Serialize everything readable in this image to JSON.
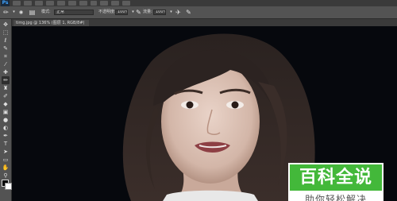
{
  "app": {
    "logo": "Ps"
  },
  "options_bar": {
    "mode_label": "模式:",
    "mode_value": "正常",
    "opacity_label": "不透明度:",
    "opacity_value": "100%",
    "flow_label": "流量:",
    "flow_value": "100%"
  },
  "document": {
    "tab_label": "timg.jpg @ 136% (图层 1, RGB/8#)"
  },
  "tools": [
    {
      "icon": "move-icon",
      "glyph": "✥"
    },
    {
      "icon": "marquee-icon",
      "glyph": "⬚"
    },
    {
      "icon": "lasso-icon",
      "glyph": "ℓ"
    },
    {
      "icon": "quick-select-icon",
      "glyph": "✎"
    },
    {
      "icon": "crop-icon",
      "glyph": "⌗"
    },
    {
      "icon": "eyedropper-icon",
      "glyph": "⁄"
    },
    {
      "icon": "healing-icon",
      "glyph": "✚"
    },
    {
      "icon": "brush-icon",
      "glyph": "✏"
    },
    {
      "icon": "stamp-icon",
      "glyph": "♜"
    },
    {
      "icon": "history-brush-icon",
      "glyph": "✐"
    },
    {
      "icon": "eraser-icon",
      "glyph": "◆"
    },
    {
      "icon": "gradient-icon",
      "glyph": "▣"
    },
    {
      "icon": "blur-icon",
      "glyph": "●"
    },
    {
      "icon": "dodge-icon",
      "glyph": "◐"
    },
    {
      "icon": "pen-icon",
      "glyph": "✒"
    },
    {
      "icon": "type-icon",
      "glyph": "T"
    },
    {
      "icon": "path-select-icon",
      "glyph": "➤"
    },
    {
      "icon": "shape-icon",
      "glyph": "▭"
    },
    {
      "icon": "hand-icon",
      "glyph": "✋"
    },
    {
      "icon": "zoom-icon",
      "glyph": "⚲"
    },
    {
      "icon": "more-icon",
      "glyph": "…"
    }
  ],
  "watermark": {
    "title": "百科全说",
    "subtitle": "助你轻松解决",
    "colors": {
      "green": "#43b83a",
      "white": "#ffffff"
    }
  }
}
